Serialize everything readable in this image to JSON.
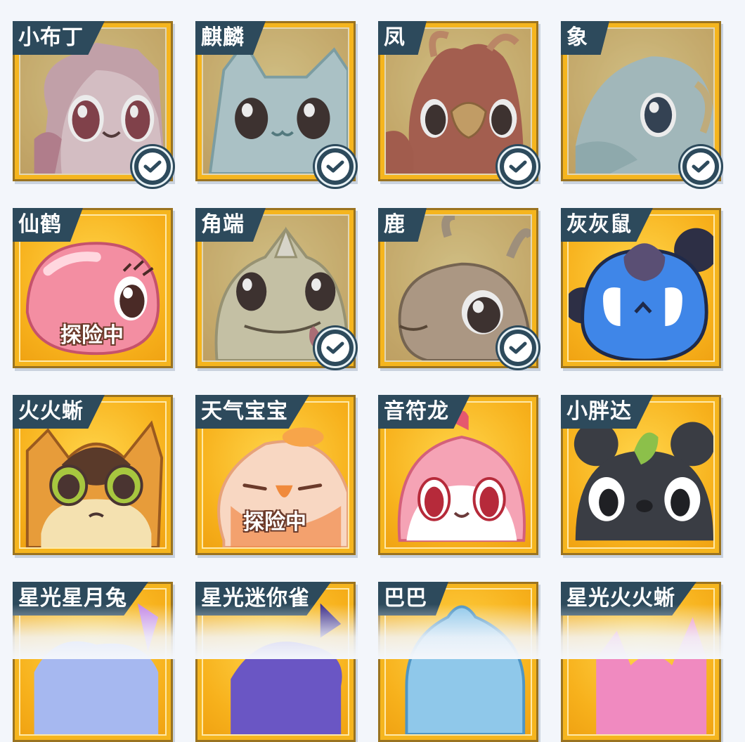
{
  "pets": [
    {
      "name": "小布丁",
      "status": "",
      "owned": true,
      "dim": true,
      "art": "pink-cat"
    },
    {
      "name": "麒麟",
      "status": "",
      "owned": true,
      "dim": true,
      "art": "blue-cat"
    },
    {
      "name": "凤",
      "status": "",
      "owned": true,
      "dim": true,
      "art": "phoenix"
    },
    {
      "name": "象",
      "status": "",
      "owned": true,
      "dim": true,
      "art": "elephant"
    },
    {
      "name": "仙鹤",
      "status": "探险中",
      "owned": false,
      "dim": false,
      "art": "crane"
    },
    {
      "name": "角端",
      "status": "",
      "owned": true,
      "dim": true,
      "art": "horn-beast"
    },
    {
      "name": "鹿",
      "status": "",
      "owned": true,
      "dim": true,
      "art": "deer"
    },
    {
      "name": "灰灰鼠",
      "status": "",
      "owned": false,
      "dim": false,
      "art": "blue-mouse"
    },
    {
      "name": "火火蜥",
      "status": "",
      "owned": false,
      "dim": false,
      "art": "fire-lizard"
    },
    {
      "name": "天气宝宝",
      "status": "探险中",
      "owned": false,
      "dim": false,
      "art": "weather-baby"
    },
    {
      "name": "音符龙",
      "status": "",
      "owned": false,
      "dim": false,
      "art": "note-dragon"
    },
    {
      "name": "小胖达",
      "status": "",
      "owned": false,
      "dim": false,
      "art": "panda"
    },
    {
      "name": "星光星月兔",
      "status": "",
      "owned": false,
      "dim": false,
      "art": "star-rabbit"
    },
    {
      "name": "星光迷你雀",
      "status": "",
      "owned": false,
      "dim": false,
      "art": "mini-bird"
    },
    {
      "name": "巴巴",
      "status": "",
      "owned": false,
      "dim": false,
      "art": "baba"
    },
    {
      "name": "星光火火蜥",
      "status": "",
      "owned": false,
      "dim": false,
      "art": "star-lizard"
    }
  ],
  "colors": {
    "tag": "#2d4a5c",
    "frame": "#9a7320",
    "gold": "#f5b51e",
    "check": "#2d4a5c"
  }
}
